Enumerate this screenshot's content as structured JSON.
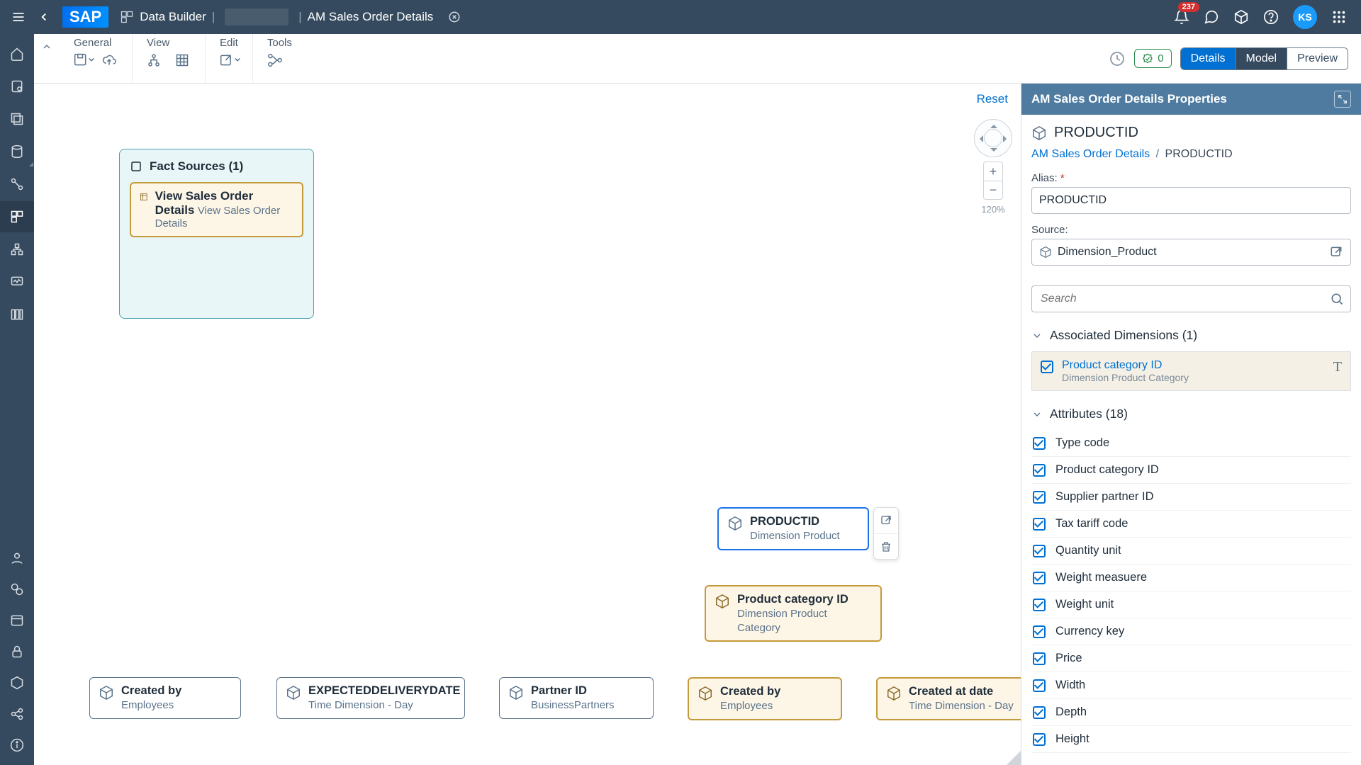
{
  "shell": {
    "app": "Data Builder",
    "title": "AM Sales Order Details",
    "notif_count": "237",
    "avatar": "KS"
  },
  "toolbar": {
    "groups": [
      "General",
      "View",
      "Edit",
      "Tools"
    ],
    "validate_count": "0",
    "segments": {
      "details": "Details",
      "model": "Model",
      "preview": "Preview"
    }
  },
  "canvas": {
    "reset": "Reset",
    "zoom": "120%",
    "fact": {
      "header": "Fact Sources (1)",
      "node_title": "View Sales Order Details",
      "node_sub": "View Sales Order Details"
    },
    "nodes": {
      "created_by1": {
        "t": "Created by",
        "s": "Employees"
      },
      "expected": {
        "t": "EXPECTEDDELIVERYDATE",
        "s": "Time Dimension - Day"
      },
      "partner": {
        "t": "Partner ID",
        "s": "BusinessPartners"
      },
      "productid": {
        "t": "PRODUCTID",
        "s": "Dimension Product"
      },
      "prodcat": {
        "t": "Product category ID",
        "s": "Dimension Product Category"
      },
      "created_by2": {
        "t": "Created by",
        "s": "Employees"
      },
      "created_at": {
        "t": "Created at date",
        "s": "Time Dimension - Day"
      }
    }
  },
  "props": {
    "panel_title": "AM Sales Order Details Properties",
    "obj": "PRODUCTID",
    "bc_root": "AM Sales Order Details",
    "bc_leaf": "PRODUCTID",
    "alias_label": "Alias:",
    "alias_value": "PRODUCTID",
    "source_label": "Source:",
    "source_value": "Dimension_Product",
    "search_ph": "Search",
    "sections": {
      "assoc": "Associated Dimensions (1)",
      "attrs": "Attributes (18)"
    },
    "assoc": {
      "t": "Product category ID",
      "s": "Dimension Product Category"
    },
    "attrs": [
      "Type code",
      "Product category ID",
      "Supplier partner ID",
      "Tax tariff code",
      "Quantity unit",
      "Weight measuere",
      "Weight unit",
      "Currency key",
      "Price",
      "Width",
      "Depth",
      "Height"
    ]
  }
}
